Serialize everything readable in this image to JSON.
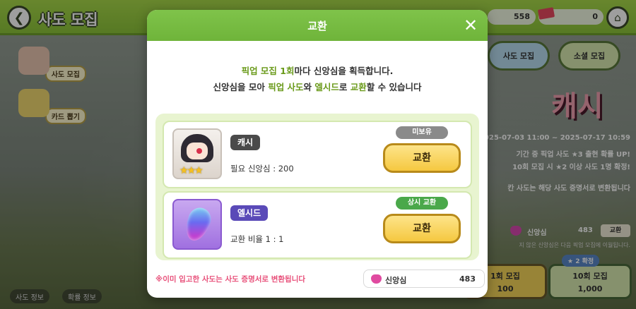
{
  "header": {
    "title": "사도 모집",
    "currency_a": "558",
    "currency_b": "0"
  },
  "sidebar": {
    "items": [
      {
        "label": "사도 모집"
      },
      {
        "label": "카드 뽑기"
      }
    ]
  },
  "footer_buttons": {
    "info": "사도 정보",
    "rates": "확률 정보"
  },
  "banner": {
    "tabs": [
      "사도 모집",
      "소셜 모집"
    ],
    "title": "캐시",
    "period": "2025-07-03 11:00 ~ 2025-07-17 10:59",
    "line1": "기간 중 픽업 사도 ★3 출현 확률 UP!",
    "line2": "10회 모집 시 ★2 이상 사도 1명 확정!",
    "line3": "칸 사도는 해당 사도 증명서로 변환됩니다",
    "faith_label": "신앙심",
    "faith_value": "483",
    "faith_exchange": "교환",
    "faith_note": "지 않은 신앙심은 다음 픽업 모집에 이월됩니다.",
    "pull1_label": "1회 모집",
    "pull1_cost": "100",
    "pull10_label": "10회 모집",
    "pull10_cost": "1,000",
    "pull10_tag": "★ 2 확정"
  },
  "modal": {
    "title": "교환",
    "close_symbol": "✕",
    "desc_line1": {
      "a": "픽업 모집 1회",
      "b": "마다 신앙심을 획득합니다."
    },
    "desc_line2": {
      "a": "신앙심을 모아 ",
      "b": "픽업 사도",
      "c": "와 ",
      "d": "엘시드",
      "e": "로 ",
      "f": "교환",
      "g": "할 수 있습니다"
    },
    "items": [
      {
        "name": "캐시",
        "sub": "필요 신앙심 : 200",
        "status": "미보유",
        "button": "교환",
        "stars": "★★★"
      },
      {
        "name": "엘시드",
        "sub": "교환 비율 1 : 1",
        "status": "상시 교환",
        "button": "교환"
      }
    ],
    "notice": "※이미 입고한 사도는 사도 증명서로 변환됩니다",
    "balance_label": "신앙심",
    "balance_value": "483"
  },
  "colors": {
    "header_green": "#7fc34a",
    "highlight": "#6a9a1a",
    "button_yellow": "#f5c840",
    "notice_pink": "#e8507a",
    "status_gray": "#8a8a8a",
    "status_green": "#4aa84a"
  }
}
